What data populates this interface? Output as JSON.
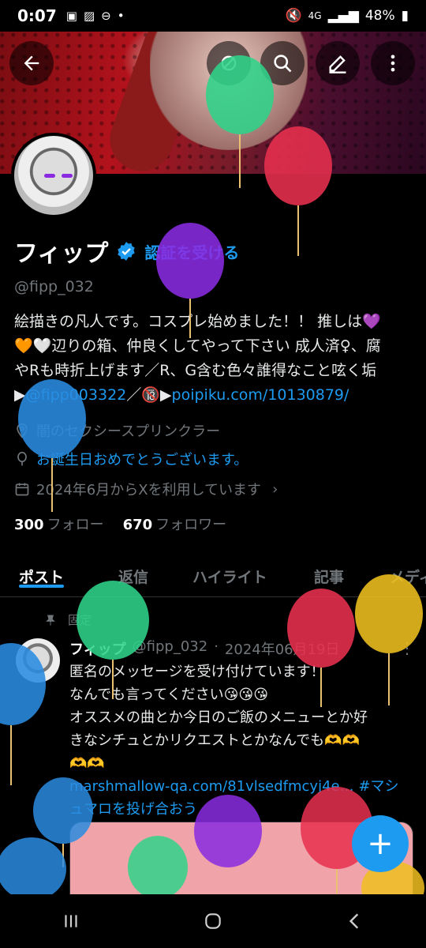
{
  "status_bar": {
    "time": "0:07",
    "icons": [
      "line-icon",
      "image-icon",
      "dnd-icon",
      "dot-icon"
    ],
    "network": "4G",
    "battery": "48%"
  },
  "top_actions": [
    "back-arrow-icon",
    "grok-icon",
    "search-icon",
    "edit-icon",
    "more-vertical-icon"
  ],
  "profile": {
    "name": "フィップ",
    "verify_label": "認証を受ける",
    "handle": "@fipp_032",
    "bio": [
      "絵描きの凡人です。コスプレ始めました！！ 推しは💜",
      "🧡🤍辺りの箱、仲良くしてやって下さい 成人済♀、腐",
      "やRも時折上げます／R、G含む色々誰得なこと呟く垢",
      "▶@fipp003322／🔞▶poipiku.com/10130879/"
    ],
    "bio_handle": "@fipp003322",
    "bio_link": "poipiku.com/10130879/",
    "location": "闇のセクシースプリンクラー",
    "birthday": "お誕生日おめでとうございます。",
    "joined": "2024年6月からXを利用しています",
    "following_count": "300",
    "following_label": "フォロー",
    "followers_count": "670",
    "followers_label": "フォロワー"
  },
  "tabs": [
    {
      "label": "ポスト",
      "active": true
    },
    {
      "label": "返信",
      "active": false
    },
    {
      "label": "ハイライト",
      "active": false
    },
    {
      "label": "記事",
      "active": false
    },
    {
      "label": "メディ",
      "active": false
    }
  ],
  "post": {
    "pinned_label": "固定",
    "name": "フィップ",
    "handle": "@fipp_032",
    "date": "2024年06月19日",
    "lines": [
      "匿名のメッセージを受け付けています！",
      "なんでも言ってください😘😘😘",
      "オススメの曲とか今日のご飯のメニューとか好",
      "きなシチュとかリクエストとかなんでも🫶🫶",
      "🫶🫶"
    ],
    "link": "marshmallow-qa.com/81vlsedfmcyj4e…",
    "hashtag": "#マシュマロを投げ合おう"
  },
  "fab_label": "+",
  "colors": {
    "accent": "#1d9bf0",
    "background": "#000000",
    "balloon_green": "#2fd38a",
    "balloon_red": "#e8304f",
    "balloon_purple": "#8a2be2",
    "balloon_blue": "#2a8ce0",
    "balloon_yellow": "#f0c020"
  }
}
